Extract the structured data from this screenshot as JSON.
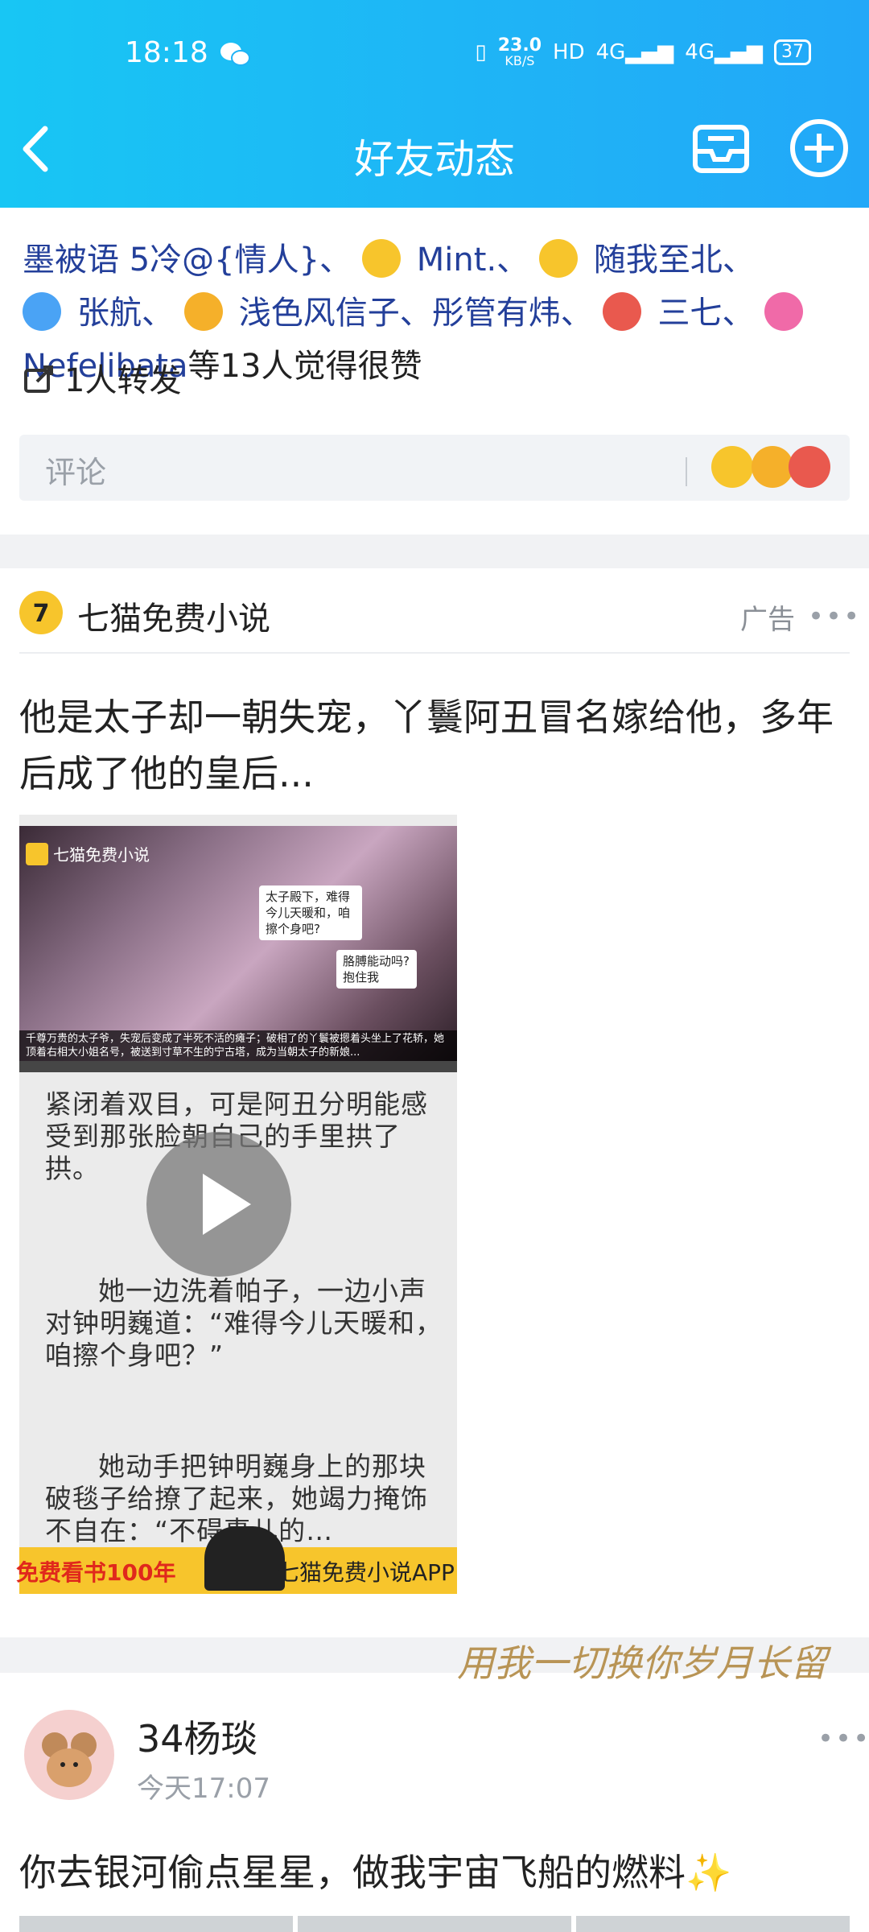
{
  "status": {
    "time": "18:18",
    "speed": "23.0",
    "speed_unit": "KB/S",
    "hd": "HD",
    "net1": "4G",
    "net2": "4G",
    "battery": "37"
  },
  "header": {
    "title": "好友动态"
  },
  "post1": {
    "likes_prefix": "墨被语 5冷@{情人}、",
    "likers": [
      "Mint.",
      "随我至北",
      "张航",
      "浅色风信子",
      "彤管有炜",
      "三七",
      "Nefelibata"
    ],
    "likes_suffix": "等13人觉得很赞",
    "forward": "1人转发",
    "comment_placeholder": "评论"
  },
  "ad": {
    "name": "七猫免费小说",
    "tag": "广告",
    "text": "他是太子却一朝失宠，丫鬟阿丑冒名嫁给他，多年后成了他的皇后...",
    "cover_logo": "七猫免费小说",
    "bubble1": "太子殿下，难得今儿天暖和，咱擦个身吧?",
    "bubble2": "胳膊能动吗?抱住我",
    "cover_caption": "千尊万贵的太子爷，失宠后变成了半死不活的瘫子；破相了的丫鬟被摁着头坐上了花轿，她顶着右相大小姐名号，被送到寸草不生的宁古塔，成为当朝太子的新娘...",
    "story1": "紧闭着双目，可是阿丑分明能感受到那张脸朝自己的手里拱了拱。",
    "story2": "她一边洗着帕子，一边小声对钟明巍道：“难得今儿天暖和，咱擦个身吧？”",
    "story3": "她动手把钟明巍身上的那块破毯子给撩了起来，她竭力掩饰不自在：“不碍事儿的…",
    "banner_left": "免费看书100年",
    "banner_right": "七猫免费小说APP"
  },
  "signature": "用我一切换你岁月长留",
  "post3": {
    "name": "34杨琰",
    "time": "今天17:07",
    "text": "你去银河偷点星星，做我宇宙飞船的燃料✨"
  }
}
